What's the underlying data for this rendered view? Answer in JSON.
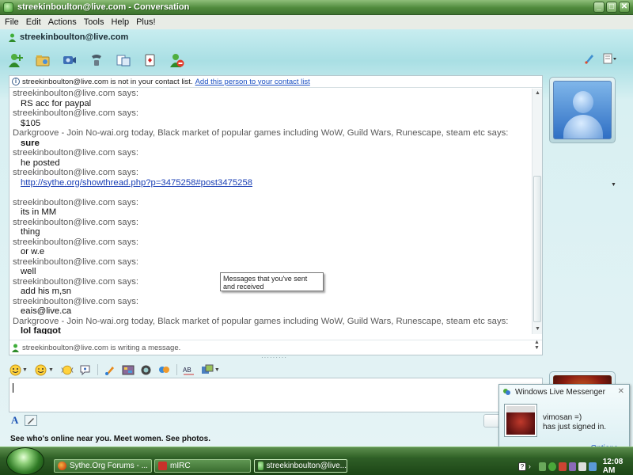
{
  "window": {
    "title": "streekinboulton@live.com - Conversation"
  },
  "menu": [
    {
      "label": "File"
    },
    {
      "label": "Edit"
    },
    {
      "label": "Actions"
    },
    {
      "label": "Tools"
    },
    {
      "label": "Help"
    },
    {
      "label": "Plus!"
    }
  ],
  "header": {
    "contact": "streekinboulton@live.com"
  },
  "toolbar": {
    "icons": [
      "invite-contact-icon",
      "send-files-icon",
      "video-call-icon",
      "voice-call-icon",
      "share-folders-icon",
      "games-icon",
      "block-icon"
    ],
    "right_icons": [
      "paint-icon",
      "menu-icon"
    ]
  },
  "notice": {
    "text": "streekinboulton@live.com is not in your contact list.",
    "link": "Add this person to your contact list"
  },
  "messages": [
    {
      "sender": "streekinboulton@live.com says:",
      "text": "RS acc for paypal",
      "style": "normal"
    },
    {
      "sender": "streekinboulton@live.com says:",
      "text": "$105",
      "style": "normal"
    },
    {
      "sender": "Darkgroove - Join No-wai.org today, Black market of popular games including WoW, Guild Wars, Runescape, steam etc says:",
      "text": "sure",
      "style": "bold"
    },
    {
      "sender": "streekinboulton@live.com says:",
      "text": "he posted",
      "style": "normal"
    },
    {
      "sender": "streekinboulton@live.com says:",
      "text": "http://sythe.org/showthread.php?p=3475258#post3475258",
      "style": "link"
    },
    {
      "sender": "streekinboulton@live.com says:",
      "text": "its in MM",
      "style": "normal"
    },
    {
      "sender": "streekinboulton@live.com says:",
      "text": "thing",
      "style": "normal"
    },
    {
      "sender": "streekinboulton@live.com says:",
      "text": "or w.e",
      "style": "normal"
    },
    {
      "sender": "streekinboulton@live.com says:",
      "text": "well",
      "style": "normal"
    },
    {
      "sender": "streekinboulton@live.com says:",
      "text": "add his m,sn",
      "style": "normal"
    },
    {
      "sender": "streekinboulton@live.com says:",
      "text": "eais@live.ca",
      "style": "normal"
    },
    {
      "sender": "Darkgroove - Join No-wai.org today, Black market of popular games including WoW, Guild Wars, Runescape, steam etc says:",
      "text": "lol faggot",
      "style": "bold"
    }
  ],
  "typing_status": "streekinboulton@live.com is writing a message.",
  "tooltip": "Messages that you've sent and received",
  "formatting": {
    "icons": [
      "emoticon-icon",
      "wink-icon",
      "nudge-icon",
      "voice-clip-icon",
      "background-icon",
      "image-icon",
      "webcam-icon",
      "msn-icon",
      "spell-check-icon",
      "more-icon"
    ]
  },
  "input": {
    "value": ""
  },
  "ad": {
    "text": "See who's online near you. Meet women. See photos."
  },
  "toast": {
    "title": "Windows Live Messenger",
    "name": "vimosan =)",
    "status": "has just signed in.",
    "options": "Options"
  },
  "taskbar": {
    "buttons": [
      {
        "label": "Sythe.Org Forums - ..."
      },
      {
        "label": "mIRC"
      },
      {
        "label": "streekinboulton@live..."
      }
    ],
    "clock": "12:08 AM"
  }
}
